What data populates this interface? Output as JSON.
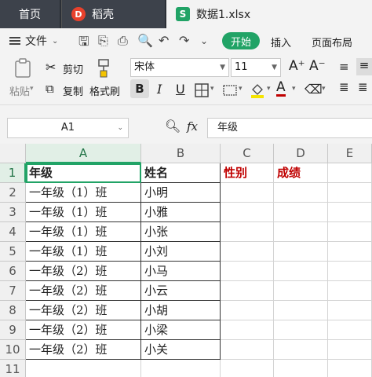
{
  "tabs": {
    "home": "首页",
    "docer": "稻壳",
    "docer_logo": "D",
    "file": "数据1.xlsx",
    "file_logo": "S"
  },
  "menu": {
    "file_label": "文件",
    "start_label": "开始",
    "insert_label": "插入",
    "layout_label": "页面布局"
  },
  "ribbon": {
    "paste_label": "粘贴",
    "cut_label": "剪切",
    "copy_label": "复制",
    "format_painter_label": "格式刷",
    "font_name": "宋体",
    "font_size": "11",
    "bold": "B",
    "italic": "I",
    "underline": "U",
    "font_color_letter": "A",
    "grow_font": "A⁺",
    "shrink_font": "A⁻"
  },
  "formula_bar": {
    "name_box": "A1",
    "fx_label": "fx",
    "value": "年级"
  },
  "sheet": {
    "columns": [
      "A",
      "B",
      "C",
      "D",
      "E"
    ],
    "rows": [
      "1",
      "2",
      "3",
      "4",
      "5",
      "6",
      "7",
      "8",
      "9",
      "10",
      "11"
    ],
    "header": {
      "a": "年级",
      "b": "姓名",
      "c": "性别",
      "d": "成绩"
    },
    "data": [
      {
        "a": "一年级（1）班",
        "b": "小明"
      },
      {
        "a": "一年级（1）班",
        "b": "小雅"
      },
      {
        "a": "一年级（1）班",
        "b": "小张"
      },
      {
        "a": "一年级（1）班",
        "b": "小刘"
      },
      {
        "a": "一年级（2）班",
        "b": "小马"
      },
      {
        "a": "一年级（2）班",
        "b": "小云"
      },
      {
        "a": "一年级（2）班",
        "b": "小胡"
      },
      {
        "a": "一年级（2）班",
        "b": "小梁"
      },
      {
        "a": "一年级（2）班",
        "b": "小关"
      }
    ]
  },
  "colors": {
    "accent": "#21a366",
    "red_header": "#c00000",
    "tabbar": "#2b2f36"
  }
}
